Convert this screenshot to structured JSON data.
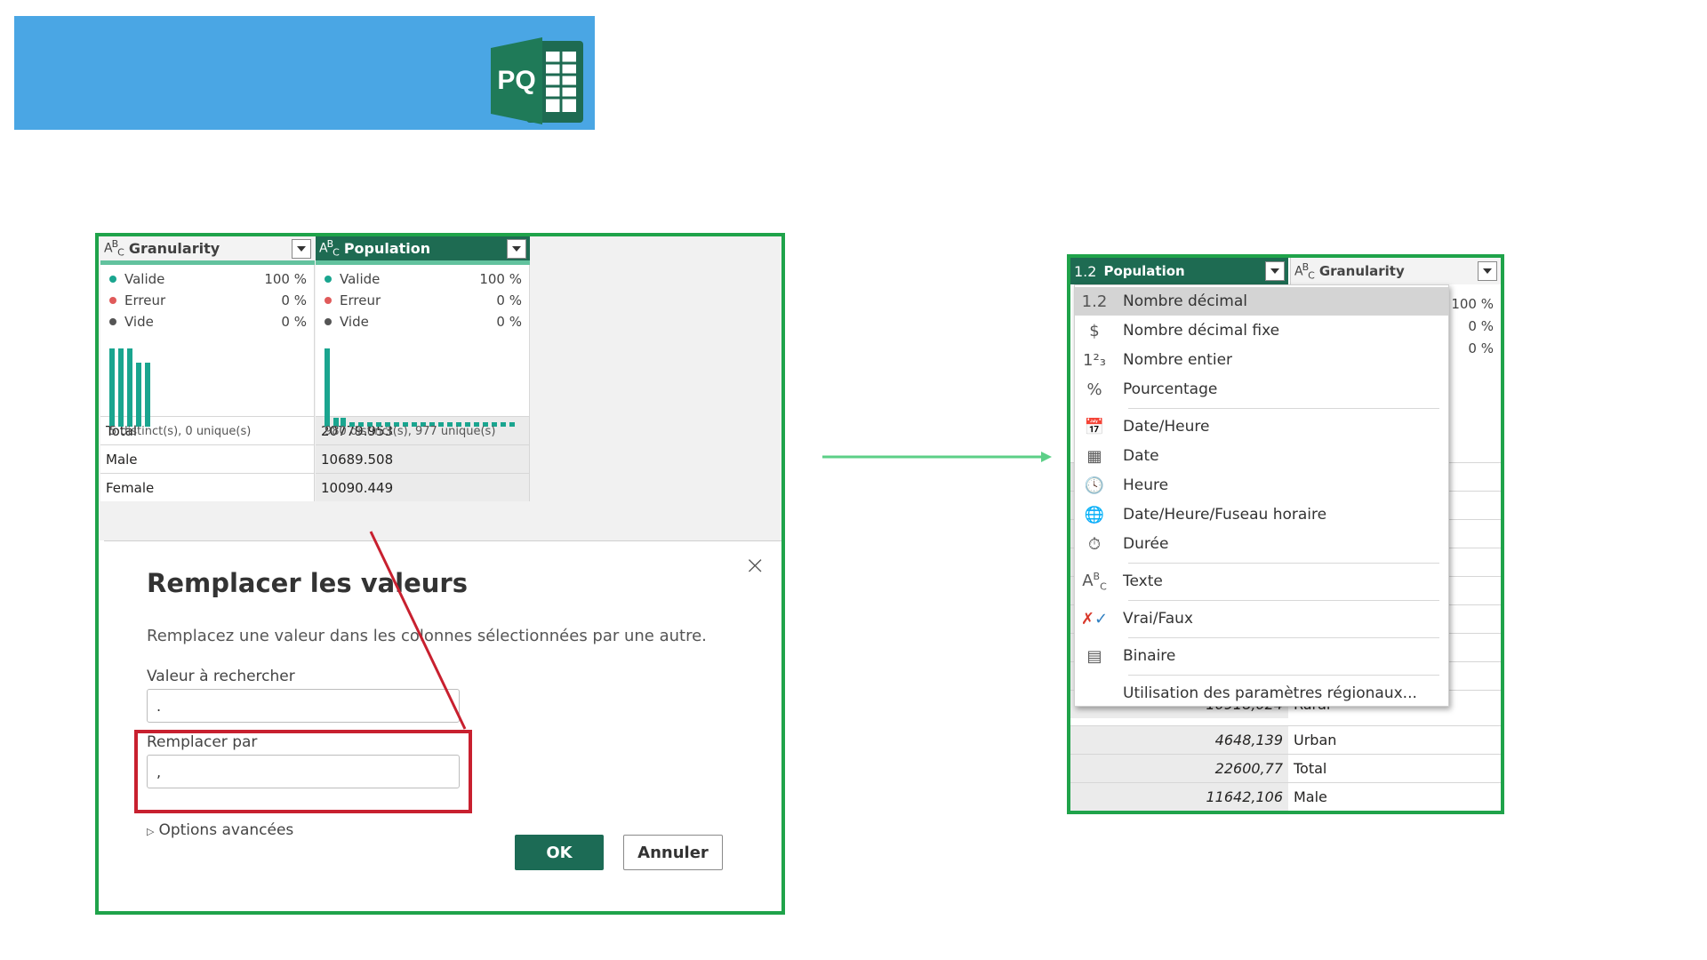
{
  "banner": {
    "logo_text": "PQ",
    "color": "#4aa6e4"
  },
  "left_panel": {
    "columns": [
      {
        "type_icon": "ABC",
        "name": "Granularity",
        "quality": [
          {
            "label": "Valide",
            "value": "100 %",
            "color": "#1aa58f"
          },
          {
            "label": "Erreur",
            "value": "0 %",
            "color": "#e05a5a"
          },
          {
            "label": "Vide",
            "value": "0 %",
            "color": "#555555"
          }
        ],
        "distinct": "5 distinct(s), 0 unique(s)",
        "cells": [
          "Total",
          "Male",
          "Female"
        ]
      },
      {
        "type_icon": "ABC",
        "name": "Population",
        "quality": [
          {
            "label": "Valide",
            "value": "100 %",
            "color": "#1aa58f"
          },
          {
            "label": "Erreur",
            "value": "0 %",
            "color": "#e05a5a"
          },
          {
            "label": "Vide",
            "value": "0 %",
            "color": "#555555"
          }
        ],
        "distinct": "980 distinct(s), 977 unique(s)",
        "cells": [
          "20779.953",
          "10689.508",
          "10090.449"
        ]
      }
    ],
    "dialog": {
      "title": "Remplacer les valeurs",
      "description": "Remplacez une valeur dans les colonnes sélectionnées par une autre.",
      "find_label": "Valeur à rechercher",
      "find_value": ".",
      "replace_label": "Remplacer par",
      "replace_value": ",",
      "advanced": "Options avancées",
      "ok": "OK",
      "cancel": "Annuler",
      "close": "×"
    }
  },
  "right_panel": {
    "header1": {
      "type_icon": "1.2",
      "name": "Population"
    },
    "header2": {
      "type_icon": "ABC",
      "name": "Granularity"
    },
    "profile_values": [
      "100 %",
      "0 %",
      "0 %"
    ],
    "partial_row": {
      "value": "10918,024",
      "label": "Rural"
    },
    "rows": [
      {
        "value": "4648,139",
        "label": "Urban"
      },
      {
        "value": "22600,77",
        "label": "Total"
      },
      {
        "value": "11642,106",
        "label": "Male"
      }
    ],
    "menu": [
      {
        "icon": "1.2",
        "label": "Nombre décimal",
        "selected": true
      },
      {
        "icon": "$",
        "label": "Nombre décimal fixe"
      },
      {
        "icon": "1²₃",
        "label": "Nombre entier"
      },
      {
        "icon": "%",
        "label": "Pourcentage"
      },
      {
        "icon": "📅",
        "label": "Date/Heure"
      },
      {
        "icon": "▦",
        "label": "Date"
      },
      {
        "icon": "🕓",
        "label": "Heure"
      },
      {
        "icon": "🌐",
        "label": "Date/Heure/Fuseau horaire"
      },
      {
        "icon": "⏱",
        "label": "Durée"
      },
      {
        "icon": "ABC",
        "label": "Texte"
      },
      {
        "icon": "✓",
        "label": "Vrai/Faux"
      },
      {
        "icon": "▤",
        "label": "Binaire"
      },
      {
        "icon": "",
        "label": "Utilisation des paramètres régionaux..."
      }
    ]
  },
  "colors": {
    "frame_green": "#1fa34a",
    "header_green": "#1e6b52",
    "highlight_red": "#c8202f"
  }
}
